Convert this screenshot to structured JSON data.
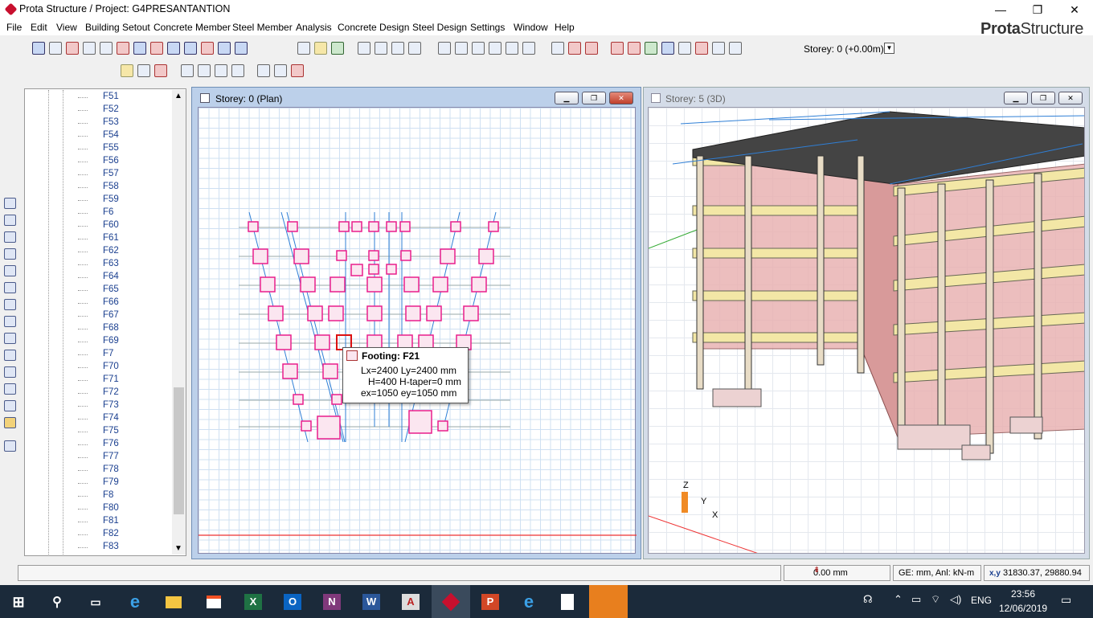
{
  "window": {
    "title": "Prota Structure / Project: G4PRESANTANTION",
    "minimize": "—",
    "maximize": "❐",
    "close": "✕"
  },
  "menu": [
    "File",
    "Edit",
    "View",
    "Building Setout",
    "Concrete Member",
    "Steel Member",
    "Analysis",
    "Concrete Design",
    "Steel Design",
    "Settings",
    "Window",
    "Help"
  ],
  "brand": {
    "bold": "Prota",
    "light": "Structure"
  },
  "toolbar": {
    "storey_label": "Storey: 0 (+0.00m)"
  },
  "tree": {
    "items": [
      "F51",
      "F52",
      "F53",
      "F54",
      "F55",
      "F56",
      "F57",
      "F58",
      "F59",
      "F6",
      "F60",
      "F61",
      "F62",
      "F63",
      "F64",
      "F65",
      "F66",
      "F67",
      "F68",
      "F69",
      "F7",
      "F70",
      "F71",
      "F72",
      "F73",
      "F74",
      "F75",
      "F76",
      "F77",
      "F78",
      "F79",
      "F8",
      "F80",
      "F81",
      "F82",
      "F83"
    ]
  },
  "plan_window": {
    "title": "Storey: 0 (Plan)"
  },
  "view3d_window": {
    "title": "Storey: 5 (3D)"
  },
  "tooltip": {
    "title": "Footing: F21",
    "line1": "Lx=2400  Ly=2400 mm",
    "line2": "H=400  H-taper=0 mm",
    "line3": "ex=1050  ey=1050 mm"
  },
  "axes": {
    "z": "Z",
    "y": "Y",
    "x": "X"
  },
  "status": {
    "elevation": "0.00 mm",
    "units": "GE: mm,  Anl: kN-m",
    "coords_label": "x,y",
    "coords": "31830.37, 29880.94"
  },
  "taskbar": {
    "apps": [
      "excel",
      "outlook",
      "onenote",
      "word",
      "autocad",
      "prota",
      "powerpoint",
      "ie",
      "notepad",
      "prota-orange"
    ],
    "lang": "ENG",
    "time": "23:56",
    "date": "12/06/2019"
  },
  "colors": {
    "accent": "#1a3f8f",
    "footing": "#e91e8c",
    "beam": "#2f7fd6",
    "wall": "#d98a8a",
    "slab": "#f3e7a6"
  }
}
